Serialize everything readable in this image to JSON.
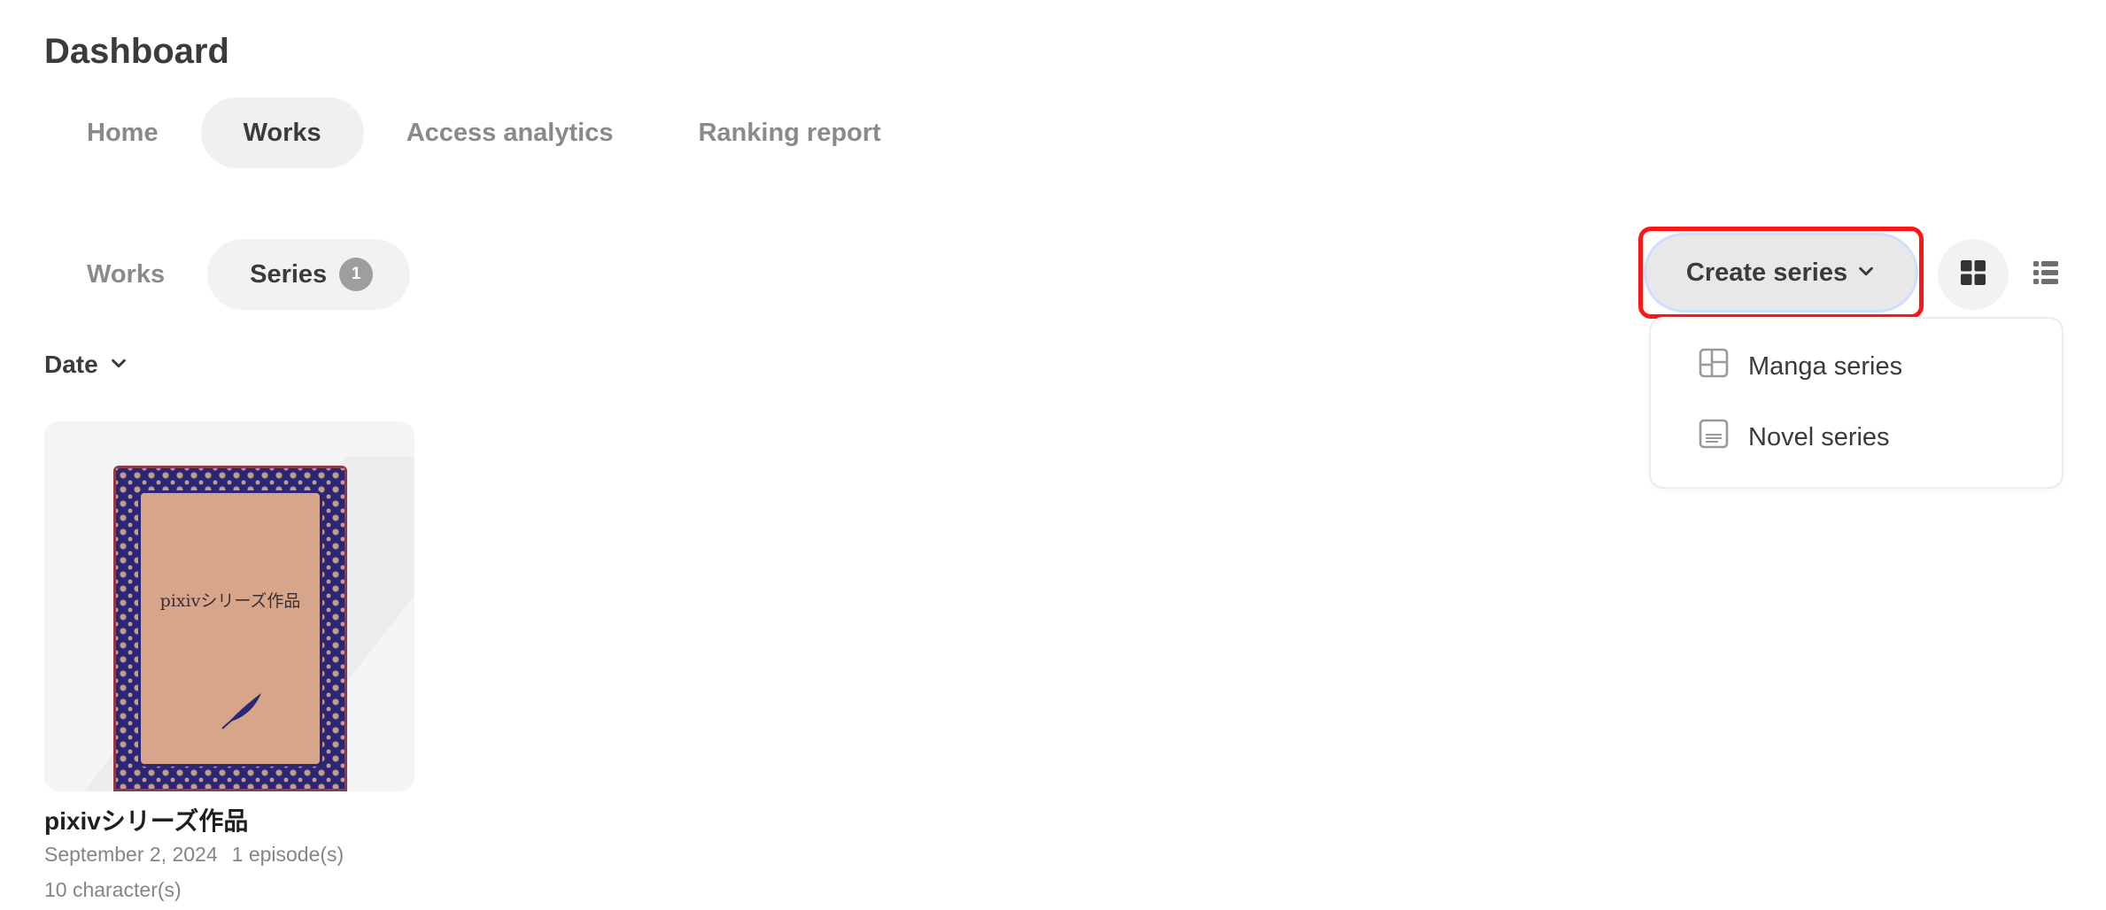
{
  "page_title": "Dashboard",
  "main_nav": [
    {
      "label": "Home",
      "active": false
    },
    {
      "label": "Works",
      "active": true
    },
    {
      "label": "Access analytics",
      "active": false
    },
    {
      "label": "Ranking report",
      "active": false
    }
  ],
  "sub_nav": [
    {
      "label": "Works",
      "active": false
    },
    {
      "label": "Series",
      "active": true,
      "count": "1"
    }
  ],
  "sort": {
    "label": "Date",
    "icon": "chevron-down-icon"
  },
  "create_series": {
    "label": "Create series",
    "icon": "chevron-down-icon",
    "highlighted": true,
    "highlight_color": "#ff1515"
  },
  "view_toggle": {
    "grid_icon": "grid-view-icon",
    "list_icon": "list-view-icon",
    "selected": "grid"
  },
  "dropdown": {
    "items": [
      {
        "label": "Manga series",
        "icon": "manga-panel-icon"
      },
      {
        "label": "Novel series",
        "icon": "novel-page-icon"
      }
    ]
  },
  "series_card": {
    "cover_title": "pixivシリーズ作品",
    "title": "pixivシリーズ作品",
    "date": "September 2, 2024",
    "episodes": "1 episode(s)",
    "characters": "10 character(s)"
  },
  "colors": {
    "text_primary": "#3b3b3b",
    "text_muted": "#8a8a8a",
    "tab_active_bg": "#f0f0f0",
    "badge_bg": "#9e9e9e",
    "cover_navy": "#2a2776",
    "cover_tan": "#d7a68a"
  }
}
